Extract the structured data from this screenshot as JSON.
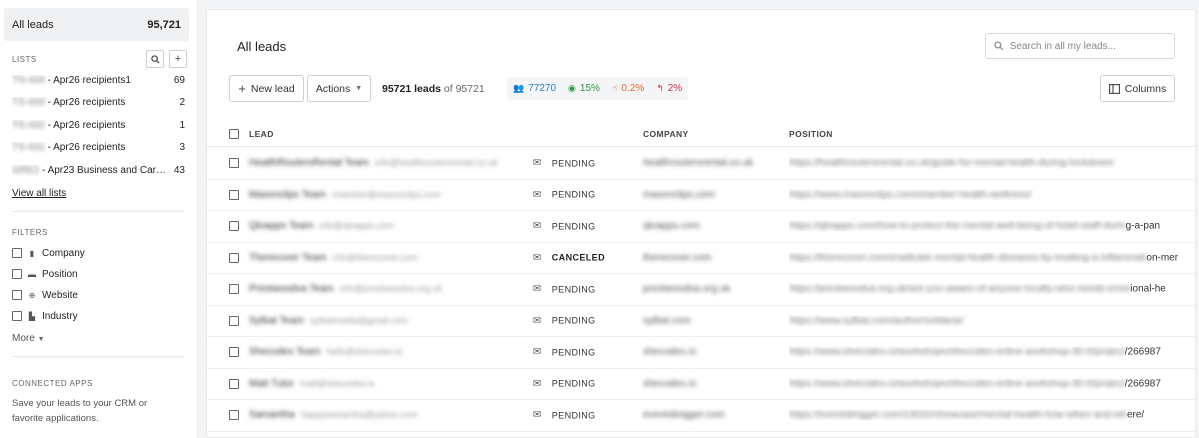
{
  "sidebar": {
    "all_leads_label": "All leads",
    "all_leads_count": "95,721",
    "lists_title": "LISTS",
    "lists": [
      {
        "code": "TS-434",
        "name": " - Apr26 recipients1",
        "count": "69"
      },
      {
        "code": "TS-433",
        "name": " - Apr26 recipients",
        "count": "2"
      },
      {
        "code": "TS-432",
        "name": " - Apr26 recipients",
        "count": "1"
      },
      {
        "code": "TS-431",
        "name": " - Apr26 recipients",
        "count": "3"
      },
      {
        "code": "GRE2",
        "name": " - Apr23 Business and Caree...",
        "count": "43"
      }
    ],
    "view_all": "View all lists",
    "filters_title": "FILTERS",
    "filters": [
      {
        "label": "Company",
        "icon": "building-icon"
      },
      {
        "label": "Position",
        "icon": "briefcase-icon"
      },
      {
        "label": "Website",
        "icon": "globe-icon"
      },
      {
        "label": "Industry",
        "icon": "factory-icon"
      }
    ],
    "more": "More",
    "connected_title": "CONNECTED APPS",
    "connected_desc": "Save your leads to your CRM or favorite applications."
  },
  "main": {
    "title": "All leads",
    "search_placeholder": "Search in all my leads...",
    "new_lead": "New lead",
    "actions": "Actions",
    "leads_count": "95721 leads",
    "leads_of": "of 95721",
    "columns": "Columns",
    "stats": [
      {
        "icon": "users-icon",
        "value": "77270",
        "color": "#2e7fd1"
      },
      {
        "icon": "eye-icon",
        "value": "15%",
        "color": "#2a9a3b"
      },
      {
        "icon": "click-icon",
        "value": "0.2%",
        "color": "#e46a2c"
      },
      {
        "icon": "reply-icon",
        "value": "2%",
        "color": "#d4334a"
      }
    ],
    "headers": {
      "lead": "LEAD",
      "company": "COMPANY",
      "position": "POSITION"
    }
  },
  "rows": [
    {
      "name": "HealthRoutersRental Team",
      "email": "info@healthroutersrental.co.uk",
      "status": "PENDING",
      "company": "healthroutersrental.co.uk",
      "position": "https://healthroutersrental.co.uk/guide-for-mental-health-during-lockdown/",
      "tail": ""
    },
    {
      "name": "Masonclips Team",
      "email": "chamber@masonclips.com",
      "status": "PENDING",
      "company": "masonclips.com",
      "position": "https://www.masonclips.com/chamber-health-wellness/",
      "tail": ""
    },
    {
      "name": "Qloapps Team",
      "email": "info@qloapps.com",
      "status": "PENDING",
      "company": "qloapps.com",
      "position": "https://qloapps.com/how-to-protect-the-mental-well-being-of-hotel-staff-durin",
      "tail": "g-a-pan"
    },
    {
      "name": "Therecover Team",
      "email": "info@therecover.com",
      "status": "CANCELED",
      "company": "therecover.com",
      "position": "https://therecover.com/eradicate-mental-health-diseases-by-treating-a-inflammati",
      "tail": "on-mer"
    },
    {
      "name": "Prestwoodva Team",
      "email": "info@prestwoodva.org.uk",
      "status": "PENDING",
      "company": "prestwoodva.org.uk",
      "position": "https://prestwoodva.org.uk/are-you-aware-of-anyone-locally-who-needs-emot",
      "tail": "ional-he"
    },
    {
      "name": "Sylbat Team",
      "email": "sylbatmedia@gmail.com",
      "status": "PENDING",
      "company": "sylbat.com",
      "position": "https://www.sylbat.com/author/sofdana/",
      "tail": ""
    },
    {
      "name": "Shecodes Team",
      "email": "hello@shecodes.io",
      "status": "PENDING",
      "company": "shecodes.io",
      "position": "https://www.shecodes.io/workshops/shecodes-online-workshop-30-0/project",
      "tail": "/266987"
    },
    {
      "name": "Matt Tutor",
      "email": "matt@shecodes.io",
      "status": "PENDING",
      "company": "shecodes.io",
      "position": "https://www.shecodes.io/workshops/shecodes-online-workshop-30-0/project",
      "tail": "/266987"
    },
    {
      "name": "Samantha",
      "email": "happysamantha@yahoo.com",
      "status": "PENDING",
      "company": "eventsbrigger.com",
      "position": "https://eventsbrigger.com/13032/showcase/mental-health-how-when-and-wh",
      "tail": "ere/"
    }
  ]
}
